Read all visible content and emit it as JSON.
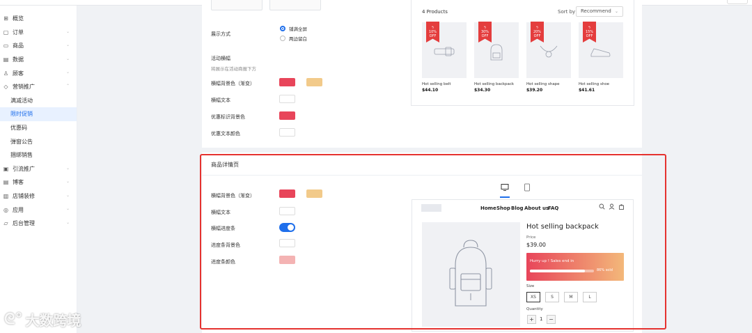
{
  "sidebar": {
    "items": [
      {
        "label": "概览",
        "icon": "grid-icon",
        "chev": ""
      },
      {
        "label": "订单",
        "icon": "order-icon",
        "chev": "⌄"
      },
      {
        "label": "商品",
        "icon": "product-icon",
        "chev": "⌄"
      },
      {
        "label": "数据",
        "icon": "data-icon",
        "chev": "⌄"
      },
      {
        "label": "顾客",
        "icon": "user-icon",
        "chev": "⌄"
      },
      {
        "label": "营销推广",
        "icon": "tag-icon",
        "chev": "⌃"
      }
    ],
    "sub_items": [
      "满减活动",
      "限时促销",
      "优惠码",
      "弹窗公告",
      "捆绑销售"
    ],
    "items2": [
      {
        "label": "引流推广",
        "icon": "promo-icon",
        "chev": "⌄"
      },
      {
        "label": "博客",
        "icon": "blog-icon",
        "chev": "⌄"
      },
      {
        "label": "店铺装修",
        "icon": "store-icon",
        "chev": "⌄"
      },
      {
        "label": "应用",
        "icon": "app-icon",
        "chev": "⌄"
      },
      {
        "label": "后台管理",
        "icon": "admin-icon",
        "chev": "⌄"
      }
    ]
  },
  "settings_top": {
    "display_mode_label": "展示方式",
    "radio_option_1": "铺满全屏",
    "radio_option_2": "两边留白",
    "banner_label": "活动横幅",
    "banner_hint": "将展示在活动商报下方",
    "banner_bg_label": "横幅背景色（渐变）",
    "banner_text_label": "横幅文本",
    "discount_tag_bg_label": "优惠标识背景色",
    "discount_text_color_label": "优惠文本颜色"
  },
  "colors": {
    "red": "#e8455a",
    "tan": "#f2ca8a",
    "white": "#ffffff",
    "pink": "#f4b3b3",
    "accent_blue": "#1f6feb",
    "highlight": "#e5322f"
  },
  "product_list": {
    "count_label": "4 Products",
    "sort_label": "Sort by",
    "sort_value": "Recommend",
    "products": [
      {
        "badge": "10% OFF",
        "name": "Hot selling belt",
        "price": "$44.10",
        "icon": "belt-icon"
      },
      {
        "badge": "30% OFF",
        "name": "Hot selling backpack",
        "price": "$34.30",
        "icon": "backpack-icon"
      },
      {
        "badge": "20% OFF",
        "name": "Hot selling shape",
        "price": "$39.20",
        "icon": "necklace-icon"
      },
      {
        "badge": "15% OFF",
        "name": "Hot selling shoe",
        "price": "$41.61",
        "icon": "shoe-icon"
      }
    ]
  },
  "detail_section": {
    "title": "商品详情页",
    "banner_bg_label": "横幅背景色（渐变）",
    "banner_text_label": "横幅文本",
    "progress_toggle_label": "横幅进度条",
    "progress_bg_label": "进度条背景色",
    "progress_color_label": "进度条颜色",
    "progress_toggle_on": true
  },
  "preview": {
    "nav": [
      "Home",
      "Shop",
      "Blog",
      "About us",
      "FAQ"
    ],
    "product_title": "Hot selling backpack",
    "price_label": "Price",
    "price": "$39.00",
    "hurry_text": "Hurry up ! Sales end in",
    "sold_text": "86% sold",
    "sold_fraction": 0.86,
    "size_label": "Size",
    "sizes": [
      "XS",
      "S",
      "M",
      "L"
    ],
    "selected_size": "XS",
    "quantity_label": "Quantity",
    "quantity": "1",
    "minus": "−",
    "plus": "+"
  },
  "watermark": {
    "logo": "ᘓ°",
    "text": "大数跨境"
  }
}
